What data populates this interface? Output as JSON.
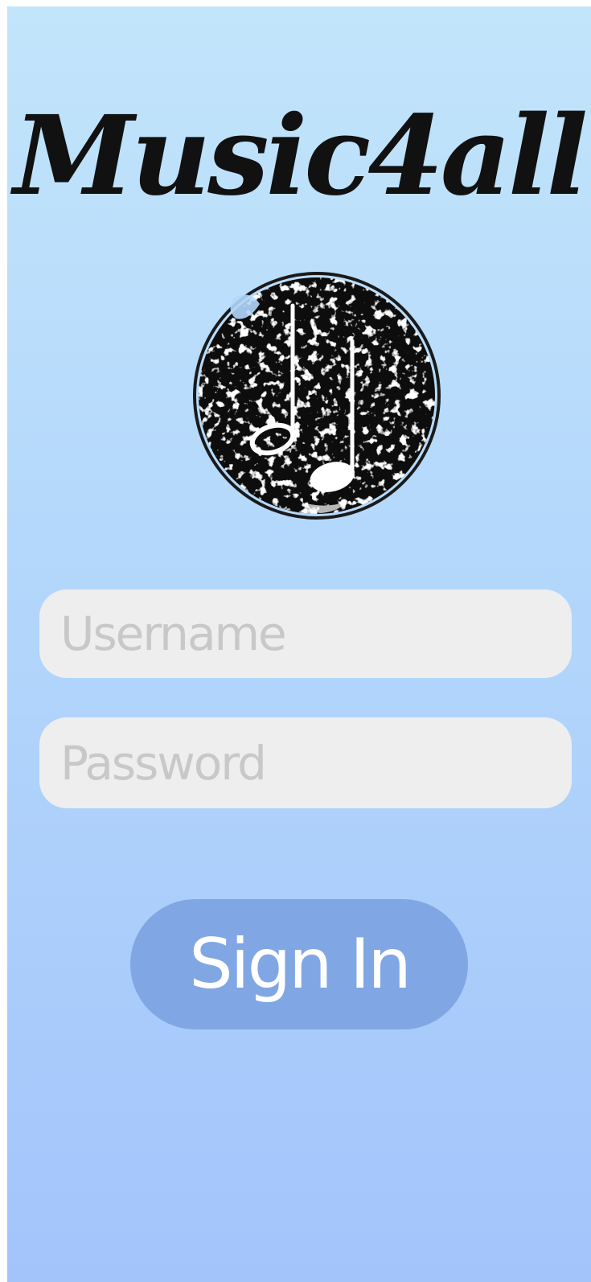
{
  "app": {
    "title": "Music4all",
    "logo_icon": "music-notes-icon"
  },
  "form": {
    "username": {
      "placeholder": "Username",
      "value": ""
    },
    "password": {
      "placeholder": "Password",
      "value": ""
    },
    "sign_in_label": "Sign In"
  },
  "colors": {
    "background_top": "#c2e5fb",
    "background_bottom": "#a3c4fb",
    "input_background": "#eeeeee",
    "placeholder_text": "#c8c8c8",
    "button_background": "#80a7e4",
    "button_text": "#ffffff",
    "title_text": "#111111"
  }
}
